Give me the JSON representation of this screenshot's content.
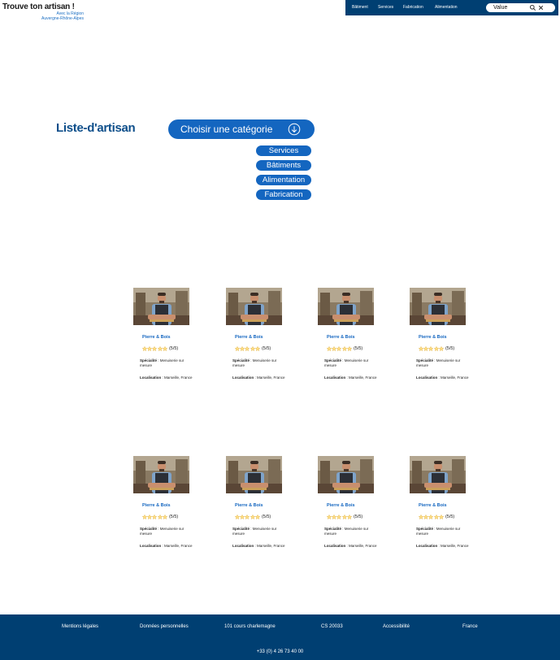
{
  "logo": {
    "title": "Trouve ton artisan !",
    "line1": "Avec la Région",
    "line2": "Auvergne-Rhône-Alpes"
  },
  "nav": {
    "items": [
      "Bâtiment",
      "Services",
      "Fabrication",
      "Alimentation"
    ],
    "search": {
      "value": "Value",
      "icon": "search-icon",
      "clear_icon": "close-icon"
    }
  },
  "main": {
    "title": "Liste-d'artisan",
    "category_button": {
      "label": "Choisir une catégorie",
      "icon": "arrow-down-circle-icon"
    },
    "categories": [
      "Services",
      "Bâtiments",
      "Alimentation",
      "Fabrication"
    ]
  },
  "cards": [
    {
      "name": "Pierre & Bois",
      "stars": 5,
      "rating": "(5/5)",
      "specialty_label": "Spécialité",
      "specialty": "Menuiserie sur mesure",
      "location_label": "Localisation",
      "location": "Marseille, France"
    },
    {
      "name": "Pierre & Bois",
      "stars": 5,
      "rating": "(5/5)",
      "specialty_label": "Spécialité",
      "specialty": "Menuiserie sur mesure",
      "location_label": "Localisation",
      "location": "Marseille, France"
    },
    {
      "name": "Pierre & Bois",
      "stars": 5,
      "rating": "(5/5)",
      "specialty_label": "Spécialité",
      "specialty": "Menuiserie sur mesure",
      "location_label": "Localisation",
      "location": "Marseille, France"
    },
    {
      "name": "Pierre & Bois",
      "stars": 5,
      "rating": "(5/5)",
      "specialty_label": "Spécialité",
      "specialty": "Menuiserie sur mesure",
      "location_label": "Localisation",
      "location": "Marseille, France"
    },
    {
      "name": "Pierre & Bois",
      "stars": 5,
      "rating": "(5/5)",
      "specialty_label": "Spécialité",
      "specialty": "Menuiserie sur mesure",
      "location_label": "Localisation",
      "location": "Marseille, France"
    },
    {
      "name": "Pierre & Bois",
      "stars": 5,
      "rating": "(5/5)",
      "specialty_label": "Spécialité",
      "specialty": "Menuiserie sur mesure",
      "location_label": "Localisation",
      "location": "Marseille, France"
    },
    {
      "name": "Pierre & Bois",
      "stars": 5,
      "rating": "(5/5)",
      "specialty_label": "Spécialité",
      "specialty": "Menuiserie sur mesure",
      "location_label": "Localisation",
      "location": "Marseille, France"
    },
    {
      "name": "Pierre & Bois",
      "stars": 5,
      "rating": "(5/5)",
      "specialty_label": "Spécialité",
      "specialty": "Menuiserie sur mesure",
      "location_label": "Localisation",
      "location": "Marseille, France"
    }
  ],
  "footer": {
    "items": [
      "Mentions légales",
      "Données personnelles",
      "101 cours charlemagne",
      "CS 20033",
      "Accessibilité",
      "France"
    ],
    "phone": "+33 (0) 4 26 73 40 00"
  },
  "colors": {
    "primary": "#1466c0",
    "nav_bg": "#003f72",
    "title": "#0d4e8a",
    "star": "#f5c518"
  }
}
